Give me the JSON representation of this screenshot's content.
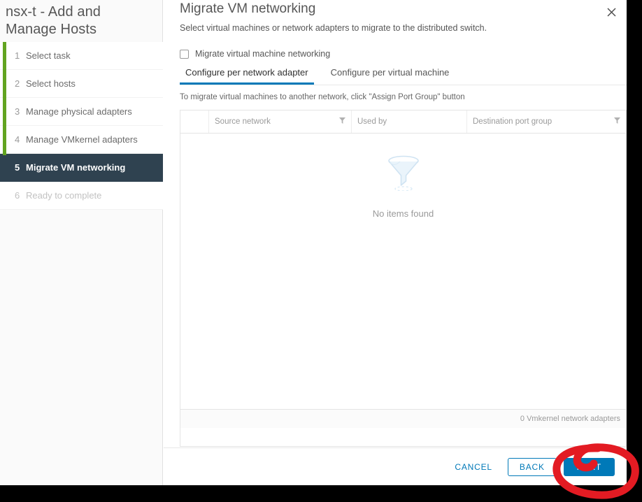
{
  "sidebar": {
    "wizard_title": "nsx-t - Add and Manage Hosts",
    "progress_color": "#62a420",
    "active_bg": "#2f4250",
    "steps": [
      {
        "num": "1",
        "label": "Select task",
        "state": "done"
      },
      {
        "num": "2",
        "label": "Select hosts",
        "state": "done"
      },
      {
        "num": "3",
        "label": "Manage physical adapters",
        "state": "done"
      },
      {
        "num": "4",
        "label": "Manage VMkernel adapters",
        "state": "done"
      },
      {
        "num": "5",
        "label": "Migrate VM networking",
        "state": "active"
      },
      {
        "num": "6",
        "label": "Ready to complete",
        "state": "disabled"
      }
    ]
  },
  "header": {
    "title": "Migrate VM networking",
    "description": "Select virtual machines or network adapters to migrate to the distributed switch.",
    "close_icon": "close-icon"
  },
  "checkbox": {
    "label": "Migrate virtual machine networking",
    "checked": false
  },
  "tabs": [
    {
      "label": "Configure per network adapter",
      "active": true
    },
    {
      "label": "Configure per virtual machine",
      "active": false
    }
  ],
  "hint": "To migrate virtual machines to another network, click \"Assign Port Group\" button",
  "table": {
    "columns": [
      {
        "label": "",
        "filter": false
      },
      {
        "label": "Source network",
        "filter": true
      },
      {
        "label": "Used by",
        "filter": false
      },
      {
        "label": "Destination port group",
        "filter": true
      }
    ],
    "rows": [],
    "empty_text": "No items found",
    "empty_icon": "funnel-icon",
    "footer_text": "0 Vmkernel network adapters"
  },
  "footer": {
    "cancel_label": "CANCEL",
    "back_label": "BACK",
    "next_label": "NEXT",
    "accent_color": "#0079b8"
  },
  "annotation": {
    "color": "#e31b23",
    "shape": "hand-drawn-circle-around-next-button"
  }
}
